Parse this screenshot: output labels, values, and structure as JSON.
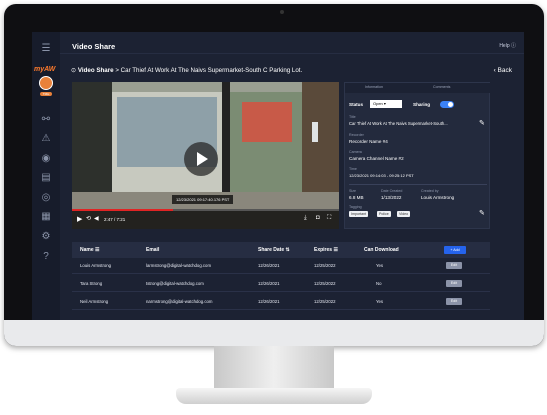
{
  "app": {
    "title": "Video Share",
    "help_label": "Help",
    "logo": "myAW",
    "avatar_badge": "TMH"
  },
  "breadcrumb": {
    "root": "Video Share",
    "separator": ">",
    "current": "Car Thief At Work At The Naivs Supermarket-South C Parking Lot."
  },
  "back_label": "Back",
  "sidebar": {
    "icons": [
      "menu-icon",
      "network-icon",
      "alert-icon",
      "camera-icon",
      "document-icon",
      "user-icon",
      "report-icon",
      "settings-icon",
      "help-icon"
    ]
  },
  "video": {
    "timestamp": "12/23/2021 09:17:40.176 PST",
    "time": "2:47 / 7:21",
    "progress": 0.38
  },
  "panel": {
    "tabs": [
      "Information",
      "Comments"
    ],
    "status_label": "Status",
    "status_value": "Open",
    "sharing_label": "Sharing",
    "title_label": "Title",
    "title_value": "Car Thief At Work At The Naivs Supermarket-South...",
    "recorder_label": "Recorder",
    "recorder_value": "Recorder Name #4",
    "camera_label": "Camera",
    "camera_value": "Camera Channel Name #2",
    "time_label": "Time",
    "time_value": "12/23/2021 09:14:03 - 09:25:12 PST",
    "size_label": "Size",
    "size_value": "6.8 MB",
    "created_label": "Date Created",
    "created_value": "1/13/2022",
    "by_label": "Created by",
    "by_value": "Louis Armstrong",
    "tagging_label": "Tagging",
    "tags": [
      "Important",
      "Police",
      "Video"
    ]
  },
  "table": {
    "headers": {
      "name": "Name",
      "email": "Email",
      "share_date": "Share Date",
      "expires": "Expires",
      "download": "Can Download",
      "add": "+ Add"
    },
    "rows": [
      {
        "name": "Louis Armstrong",
        "email": "larmstrong@digital-watchdog.com",
        "share_date": "12/26/2021",
        "expires": "12/25/2022",
        "download": "Yes",
        "action": "Edit"
      },
      {
        "name": "Tara Strong",
        "email": "tstrong@digital-watchdog.com",
        "share_date": "12/26/2021",
        "expires": "12/25/2022",
        "download": "No",
        "action": "Edit"
      },
      {
        "name": "Neil Armstrong",
        "email": "narmstrong@digital-watchdog.com",
        "share_date": "12/26/2021",
        "expires": "12/25/2022",
        "download": "Yes",
        "action": "Edit"
      }
    ]
  }
}
